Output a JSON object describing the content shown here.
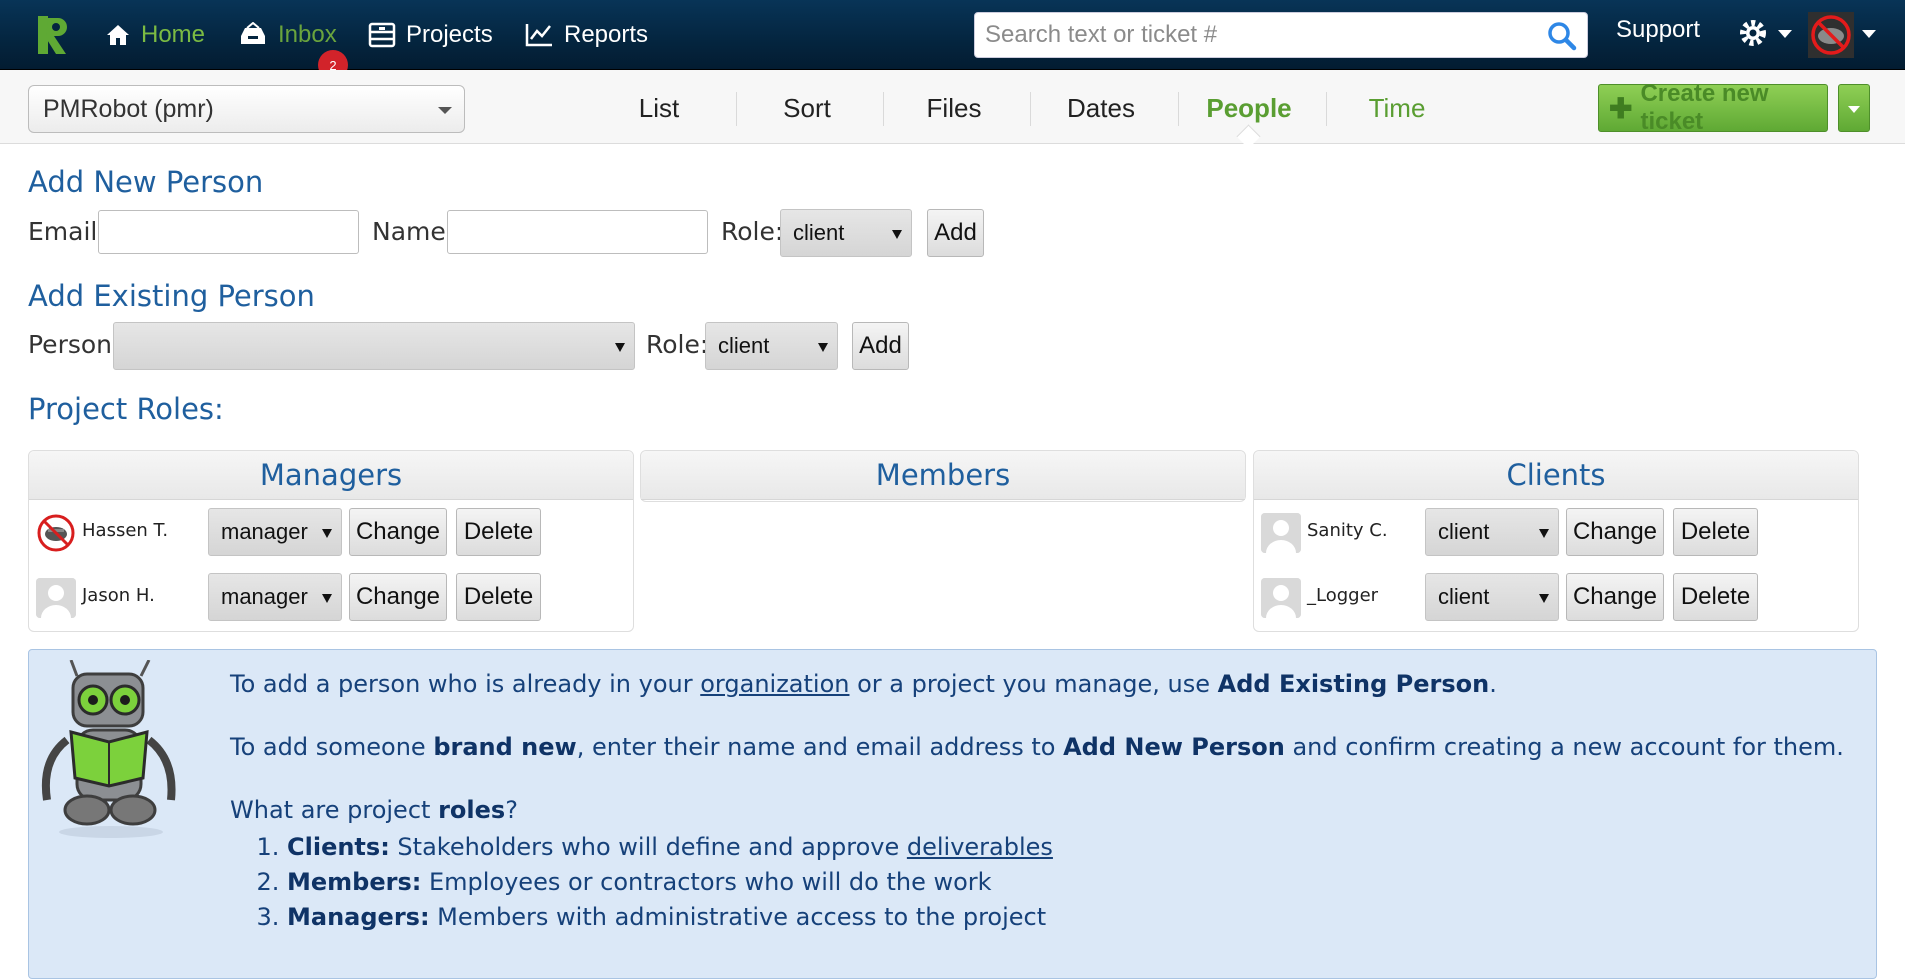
{
  "colors": {
    "topbar": "#04253f",
    "accent_green": "#5a9e32",
    "heading_blue": "#1f5f9e",
    "info_bg": "#dbe8f7",
    "badge_red": "#d2232a"
  },
  "topnav": {
    "home": "Home",
    "inbox": "Inbox",
    "inbox_badge": "2",
    "projects": "Projects",
    "reports": "Reports",
    "search_placeholder": "Search text or ticket #",
    "support": "Support"
  },
  "subnav": {
    "project": "PMRobot (pmr)",
    "tabs": {
      "list": "List",
      "sort": "Sort",
      "files": "Files",
      "dates": "Dates",
      "people": "People",
      "time": "Time"
    },
    "active_tab": "People",
    "create_ticket": "Create new ticket"
  },
  "add_new_person": {
    "title": "Add New Person",
    "email_label": "Email:",
    "email_value": "",
    "name_label": "Name:",
    "name_value": "",
    "role_label": "Role:",
    "role_value": "client",
    "add_button": "Add"
  },
  "add_existing_person": {
    "title": "Add Existing Person",
    "person_label": "Person:",
    "person_value": "",
    "role_label": "Role:",
    "role_value": "client",
    "add_button": "Add"
  },
  "project_roles": {
    "title": "Project Roles:",
    "managers": {
      "title": "Managers",
      "people": [
        {
          "name": "Hassen T.",
          "role": "manager",
          "change": "Change",
          "delete": "Delete",
          "avatar": "no-bug-icon"
        },
        {
          "name": "Jason H.",
          "role": "manager",
          "change": "Change",
          "delete": "Delete",
          "avatar": "default-avatar-icon"
        }
      ]
    },
    "members": {
      "title": "Members",
      "people": []
    },
    "clients": {
      "title": "Clients",
      "people": [
        {
          "name": "Sanity C.",
          "role": "client",
          "change": "Change",
          "delete": "Delete",
          "avatar": "default-avatar-icon"
        },
        {
          "name": "_Logger",
          "role": "client",
          "change": "Change",
          "delete": "Delete",
          "avatar": "default-avatar-icon"
        }
      ]
    }
  },
  "help": {
    "p1_pre": "To add a person who is already in your ",
    "p1_link": "organization",
    "p1_mid": " or a project you manage, use ",
    "p1_bold": "Add Existing Person",
    "p1_post": ".",
    "p2_pre": "To add someone ",
    "p2_bold1": "brand new",
    "p2_mid": ", enter their name and email address to ",
    "p2_bold2": "Add New Person",
    "p2_post": " and confirm creating a new account for them.",
    "p3_pre": "What are project ",
    "p3_bold": "roles",
    "p3_post": "?",
    "roles": [
      {
        "term": "Clients:",
        "desc": " Stakeholders who will define and approve ",
        "link": "deliverables"
      },
      {
        "term": "Members:",
        "desc": " Employees or contractors who will do the work",
        "link": ""
      },
      {
        "term": "Managers:",
        "desc": " Members with administrative access to the project",
        "link": ""
      }
    ]
  }
}
